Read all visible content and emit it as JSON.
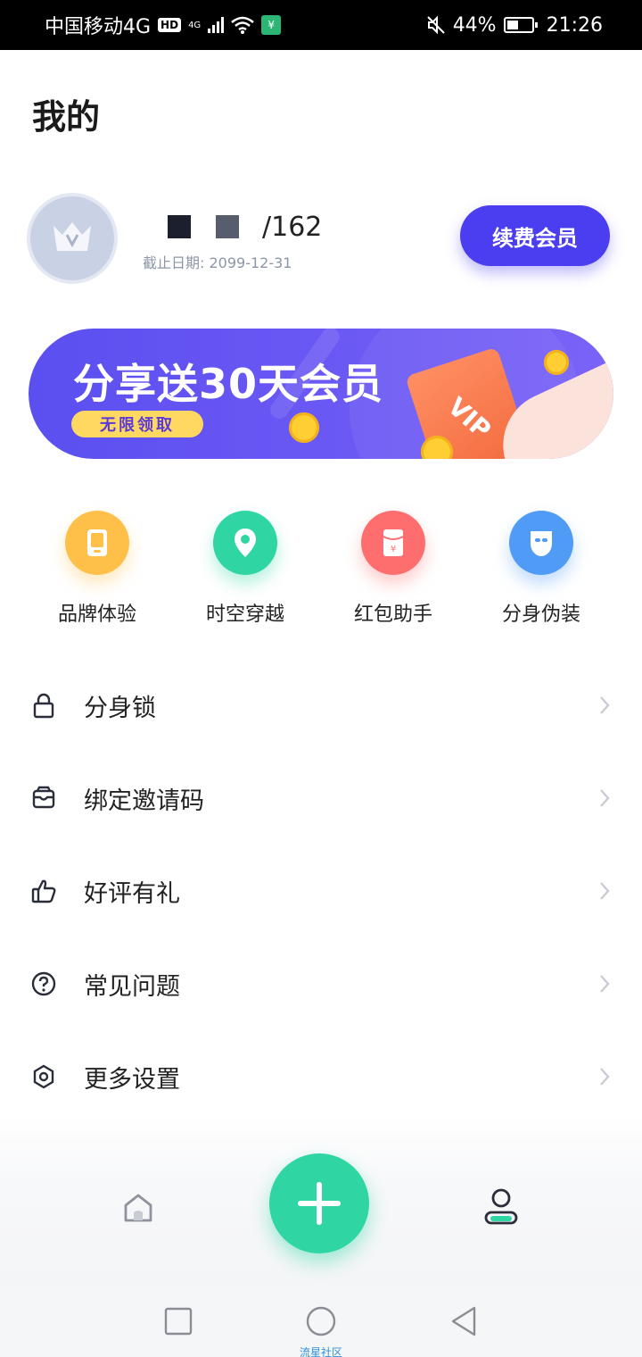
{
  "status_bar": {
    "carrier": "中国移动4G",
    "hd_badge": "HD",
    "network": "4G",
    "battery": "44%",
    "time": "21:26"
  },
  "page": {
    "title": "我的"
  },
  "profile": {
    "name_suffix": "162",
    "expire_text": "截止日期: 2099-12-31",
    "renew_label": "续费会员"
  },
  "banner": {
    "title": "分享送30天会员",
    "badge": "无限领取",
    "card_text": "VIP"
  },
  "quick_actions": [
    {
      "label": "品牌体验",
      "icon": "tablet-icon",
      "color": "#ffc04a"
    },
    {
      "label": "时空穿越",
      "icon": "location-pin-icon",
      "color": "#2fd6a3"
    },
    {
      "label": "红包助手",
      "icon": "red-envelope-icon",
      "color": "#ff6e6e"
    },
    {
      "label": "分身伪装",
      "icon": "mask-icon",
      "color": "#4f9bf5"
    }
  ],
  "menu": [
    {
      "label": "分身锁",
      "icon": "lock-icon"
    },
    {
      "label": "绑定邀请码",
      "icon": "envelope-icon"
    },
    {
      "label": "好评有礼",
      "icon": "thumbs-up-icon"
    },
    {
      "label": "常见问题",
      "icon": "question-circle-icon"
    },
    {
      "label": "更多设置",
      "icon": "settings-icon"
    }
  ],
  "tabbar": {
    "home_icon": "home-icon",
    "add_icon": "plus-icon",
    "profile_icon": "user-icon",
    "accent": "#2fd6a3"
  },
  "sysnav": {
    "watermark": "流星社区"
  },
  "colors": {
    "primary": "#4a3ef0",
    "accent": "#2fd6a3"
  }
}
